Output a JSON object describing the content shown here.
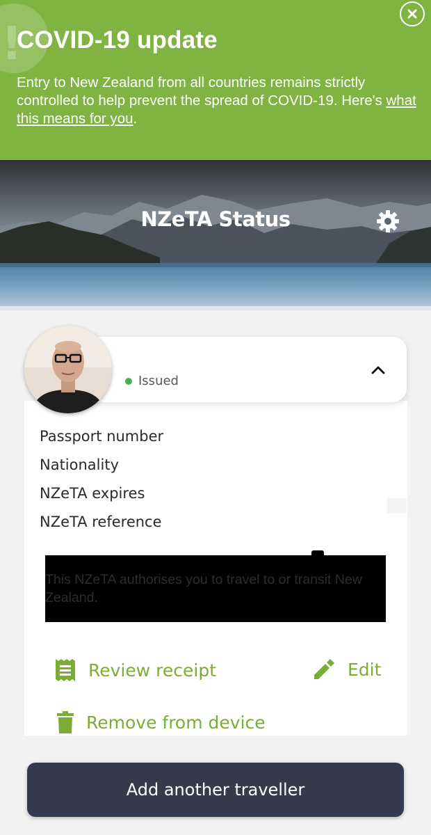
{
  "banner": {
    "title": "COVID-19 update",
    "body": "Entry to New Zealand from all countries remains strictly controlled to help prevent the spread of COVID-19. Here's ",
    "link_text": "what this means for you",
    "trailing": ".",
    "close_icon": "close-icon",
    "alert_icon": "exclamation-icon"
  },
  "hero": {
    "title": "NZeTA Status",
    "settings_icon": "gear-icon"
  },
  "traveller": {
    "status": "Issued",
    "status_color": "#4caf50",
    "fields": {
      "passport": "Passport number",
      "nationality": "Nationality",
      "expires": "NZeTA expires",
      "reference": "NZeTA reference"
    },
    "authorisation_text": "This NZeTA authorises you to travel to or transit New Zealand."
  },
  "actions": {
    "review_receipt": "Review receipt",
    "edit": "Edit",
    "remove": "Remove from device"
  },
  "add_button": "Add another traveller",
  "colors": {
    "accent_green": "#80b341",
    "action_green": "#7aad33",
    "button_dark": "#373a4d"
  }
}
